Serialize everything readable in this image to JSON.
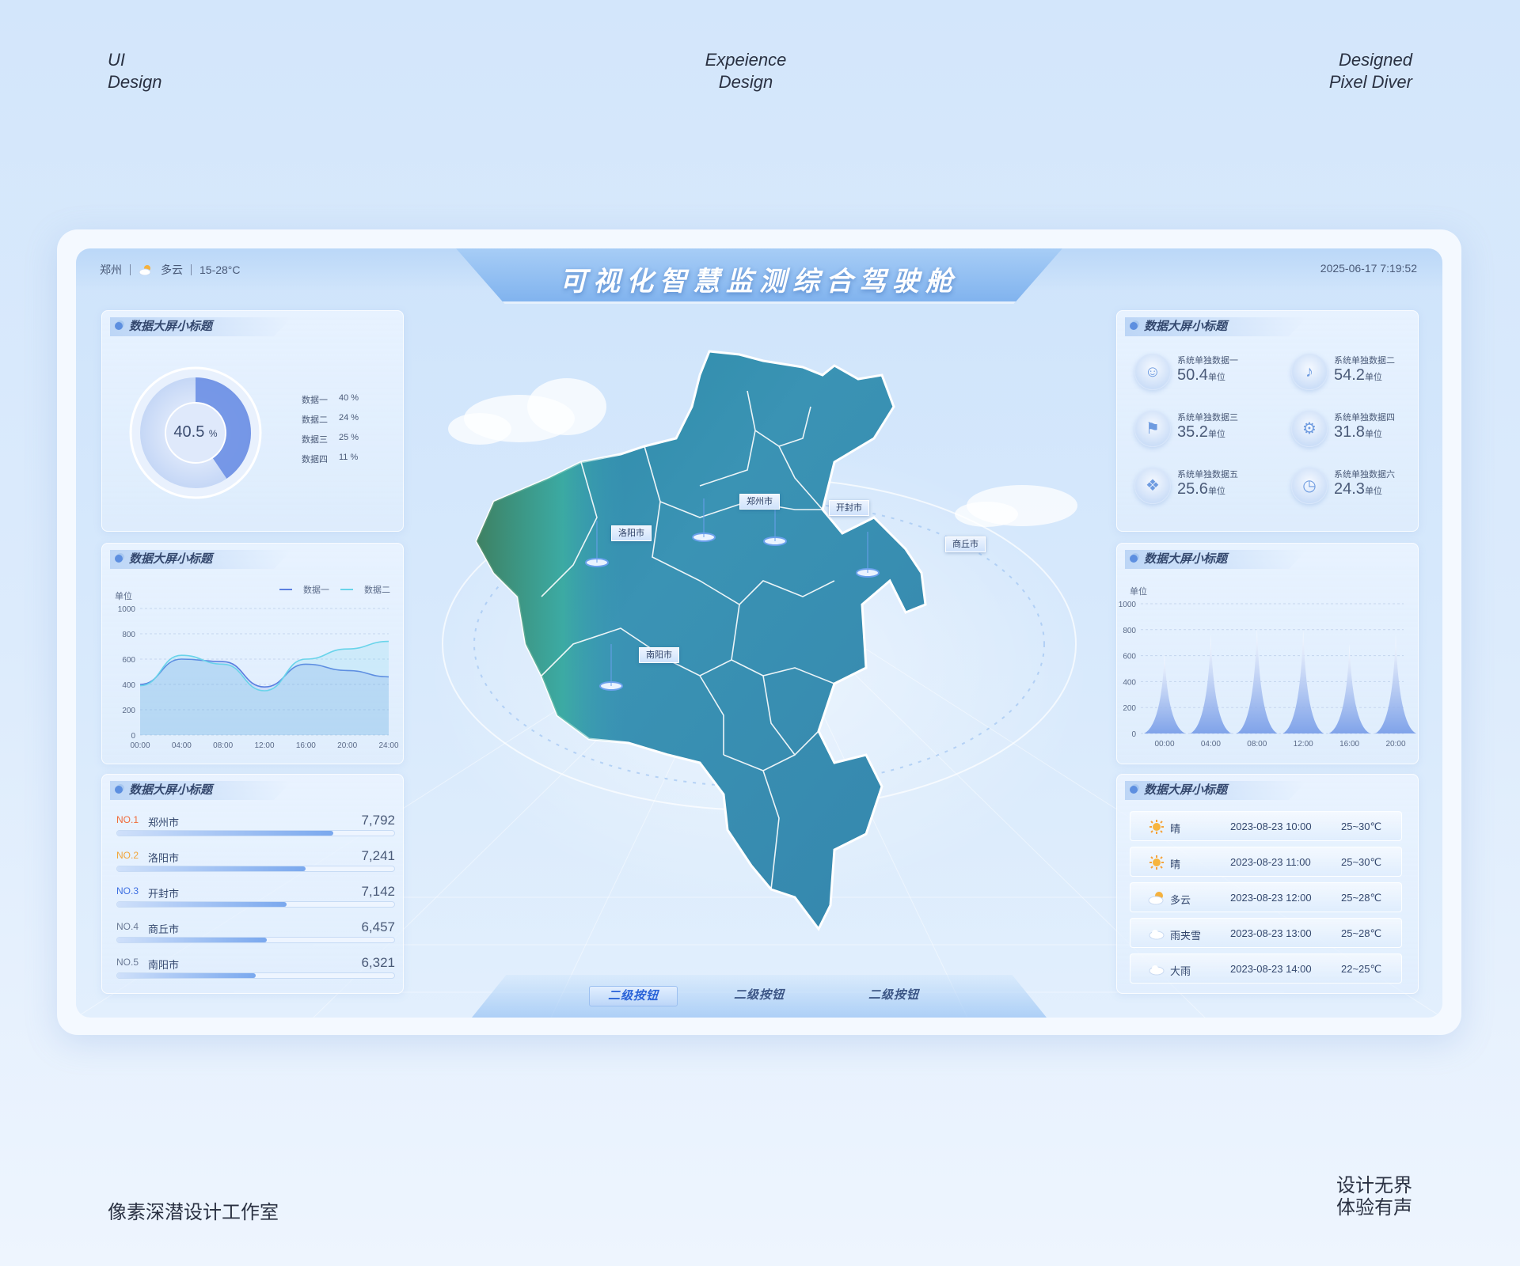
{
  "corners": {
    "top_left": [
      "UI",
      "Design"
    ],
    "top_center": [
      "Expeience",
      "Design"
    ],
    "top_right": [
      "Designed",
      "Pixel Diver"
    ],
    "bottom_left": "像素深潜设计工作室",
    "bottom_right": [
      "设计无界",
      "体验有声"
    ]
  },
  "header": {
    "city": "郑州",
    "weather": "多云",
    "temp_range": "15-28°C",
    "title": "可视化智慧监测综合驾驶舱",
    "datetime": "2025-06-17 7:19:52"
  },
  "donut_panel": {
    "title": "数据大屏小标题",
    "center_value": "40.5",
    "center_unit": "%",
    "items": [
      {
        "label": "数据一",
        "value": "40 %",
        "pct": 40
      },
      {
        "label": "数据二",
        "value": "24 %",
        "pct": 24
      },
      {
        "label": "数据三",
        "value": "25 %",
        "pct": 25
      },
      {
        "label": "数据四",
        "value": "11 %",
        "pct": 11
      }
    ]
  },
  "line_panel": {
    "title": "数据大屏小标题",
    "unit_label": "单位",
    "legend": [
      "数据一",
      "数据二"
    ],
    "chart_data": {
      "type": "area",
      "x": [
        "00:00",
        "04:00",
        "08:00",
        "12:00",
        "16:00",
        "20:00",
        "24:00"
      ],
      "ylim": [
        0,
        1000
      ],
      "yticks": [
        0,
        200,
        400,
        600,
        800,
        1000
      ],
      "series": [
        {
          "name": "数据一",
          "values": [
            400,
            600,
            580,
            380,
            560,
            510,
            460
          ]
        },
        {
          "name": "数据二",
          "values": [
            390,
            630,
            560,
            350,
            600,
            680,
            740
          ]
        }
      ],
      "colors": [
        "#5b7fe0",
        "#69d4ea"
      ]
    }
  },
  "rank_panel": {
    "title": "数据大屏小标题",
    "items": [
      {
        "no": "NO.1",
        "city": "郑州市",
        "value": "7,792",
        "ratio": 0.78,
        "color": "#f06a3a"
      },
      {
        "no": "NO.2",
        "city": "洛阳市",
        "value": "7,241",
        "ratio": 0.68,
        "color": "#f2a53a"
      },
      {
        "no": "NO.3",
        "city": "开封市",
        "value": "7,142",
        "ratio": 0.61,
        "color": "#3d6fe2"
      },
      {
        "no": "NO.4",
        "city": "商丘市",
        "value": "6,457",
        "ratio": 0.54,
        "color": "#6b7a96"
      },
      {
        "no": "NO.5",
        "city": "南阳市",
        "value": "6,321",
        "ratio": 0.5,
        "color": "#6b7a96"
      }
    ]
  },
  "stats_panel": {
    "title": "数据大屏小标题",
    "items": [
      {
        "label": "系统单独数据一",
        "value": "50.4",
        "unit": "单位",
        "icon": "user-icon"
      },
      {
        "label": "系统单独数据二",
        "value": "54.2",
        "unit": "单位",
        "icon": "bell-icon"
      },
      {
        "label": "系统单独数据三",
        "value": "35.2",
        "unit": "单位",
        "icon": "shirt-icon"
      },
      {
        "label": "系统单独数据四",
        "value": "31.8",
        "unit": "单位",
        "icon": "gear-icon"
      },
      {
        "label": "系统单独数据五",
        "value": "25.6",
        "unit": "单位",
        "icon": "gift-icon"
      },
      {
        "label": "系统单独数据六",
        "value": "24.3",
        "unit": "单位",
        "icon": "clock-icon"
      }
    ]
  },
  "peak_panel": {
    "title": "数据大屏小标题",
    "unit_label": "单位",
    "chart_data": {
      "type": "area",
      "x": [
        "00:00",
        "04:00",
        "08:00",
        "12:00",
        "16:00",
        "20:00"
      ],
      "ylim": [
        0,
        1000
      ],
      "yticks": [
        0,
        200,
        400,
        600,
        800,
        1000
      ],
      "values": [
        620,
        760,
        820,
        800,
        690,
        760
      ]
    }
  },
  "weather_panel": {
    "title": "数据大屏小标题",
    "rows": [
      {
        "cond": "晴",
        "time": "2023-08-23 10:00",
        "temp": "25~30℃",
        "icon": "sun-icon"
      },
      {
        "cond": "晴",
        "time": "2023-08-23 11:00",
        "temp": "25~30℃",
        "icon": "sun-icon"
      },
      {
        "cond": "多云",
        "time": "2023-08-23 12:00",
        "temp": "25~28℃",
        "icon": "partly-cloudy-icon"
      },
      {
        "cond": "雨夹雪",
        "time": "2023-08-23 13:00",
        "temp": "25~28℃",
        "icon": "cloud-icon"
      },
      {
        "cond": "大雨",
        "time": "2023-08-23 14:00",
        "temp": "22~25℃",
        "icon": "cloud-icon"
      }
    ]
  },
  "map": {
    "labels": [
      "洛阳市",
      "郑州市",
      "开封市",
      "商丘市",
      "南阳市"
    ]
  },
  "nav": {
    "buttons": [
      "二级按钮",
      "二级按钮",
      "二级按钮"
    ]
  }
}
